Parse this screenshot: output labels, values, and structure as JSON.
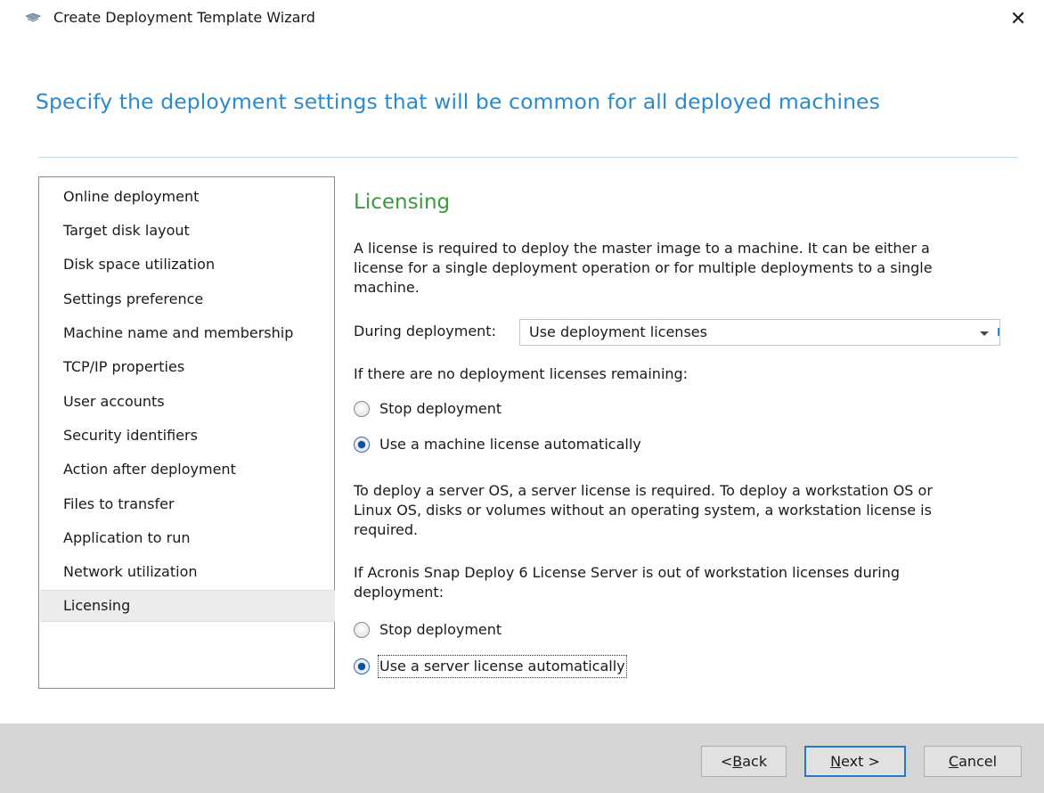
{
  "window": {
    "title": "Create Deployment Template Wizard",
    "close_label": "✕"
  },
  "header": {
    "heading": "Specify the deployment settings that will be common for all deployed machines"
  },
  "nav": {
    "items": [
      {
        "label": "Online deployment"
      },
      {
        "label": "Target disk layout"
      },
      {
        "label": "Disk space utilization"
      },
      {
        "label": "Settings preference"
      },
      {
        "label": "Machine name and membership"
      },
      {
        "label": "TCP/IP properties"
      },
      {
        "label": "User accounts"
      },
      {
        "label": "Security identifiers"
      },
      {
        "label": "Action after deployment"
      },
      {
        "label": "Files to transfer"
      },
      {
        "label": "Application to run"
      },
      {
        "label": "Network utilization"
      },
      {
        "label": "Licensing"
      }
    ],
    "selected": "Licensing"
  },
  "content": {
    "section_title": "Licensing",
    "intro_line1": "A license is required to deploy the master image to a machine. It can be either a",
    "intro_line2": "license for a single deployment operation or for multiple deployments to a single",
    "intro_line3": "machine.",
    "during_deployment_label": "During deployment:",
    "during_deployment_value": "Use deployment licenses",
    "no_licenses_label": "If there are no deployment licenses remaining:",
    "radio_group1": [
      {
        "label": "Stop deployment",
        "checked": false
      },
      {
        "label": "Use a machine license automatically",
        "checked": true
      }
    ],
    "server_note_line1": "To deploy a server OS, a server license is required. To deploy a workstation OS or",
    "server_note_line2": "Linux OS, disks or volumes without an operating system, a workstation license is",
    "server_note_line3": "required.",
    "out_of_ws_line1": "If Acronis Snap Deploy 6 License Server is out of workstation licenses during",
    "out_of_ws_line2": "deployment:",
    "radio_group2": [
      {
        "label": "Stop deployment",
        "checked": false
      },
      {
        "label": "Use a server license automatically",
        "checked": true
      }
    ]
  },
  "footer": {
    "back_prefix": "< ",
    "back_key": "B",
    "back_rest": "ack",
    "next_key": "N",
    "next_rest": "ext >",
    "cancel_key": "C",
    "cancel_rest": "ancel"
  },
  "colors": {
    "heading": "#2a8ad0",
    "section_title": "#3c9a3c",
    "footer_bg": "#d6d6d6",
    "primary_border": "#2a79c9"
  },
  "icons": {
    "window_icon": "wizard-icon",
    "close": "close-icon",
    "dropdown": "chevron-down-icon"
  }
}
